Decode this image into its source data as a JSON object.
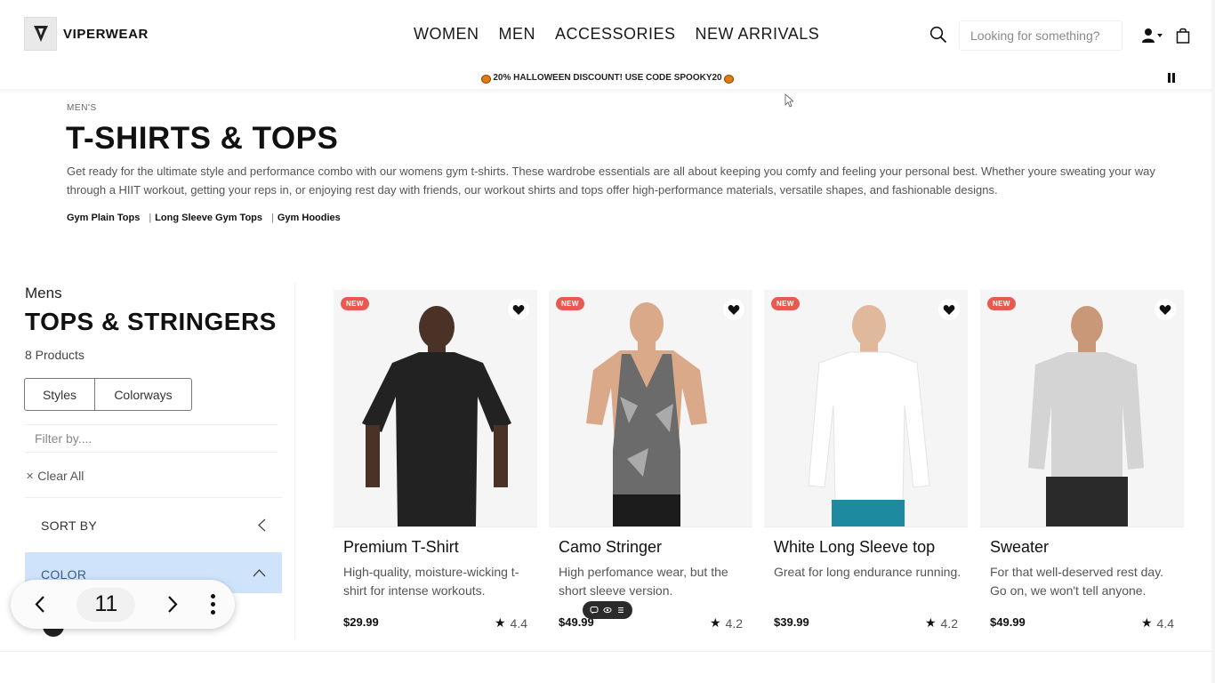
{
  "header": {
    "brand": "VIPERWEAR",
    "nav": [
      "WOMEN",
      "MEN",
      "ACCESSORIES",
      "NEW ARRIVALS"
    ],
    "search_placeholder": "Looking for something?",
    "icons": [
      "viper-logo-icon",
      "search-icon",
      "user-icon",
      "shopping-bag-icon"
    ]
  },
  "promo": {
    "text": "20% HALLOWEEN DISCOUNT! USE CODE SPOOKY20",
    "icon": "pumpkin-icon",
    "control": "pause-icon"
  },
  "intro": {
    "breadcrumb": "MEN'S",
    "title": "T-SHIRTS & TOPS",
    "description": "Get ready for the ultimate style and performance combo with our womens gym t-shirts. These wardrobe essentials are all about keeping you comfy and feeling your personal best. Whether youre sweating your way through a HIIT workout, getting your reps in, or enjoying rest day with friends, our workout shirts and tops offer high-performance materials, versatile shapes, and fashionable designs.",
    "links": [
      "Gym Plain Tops",
      "Long Sleeve Gym Tops",
      "Gym Hoodies"
    ]
  },
  "sidebar": {
    "label": "Mens",
    "title": "TOPS & STRINGERS",
    "count": "8 Products",
    "tabs": [
      "Styles",
      "Colorways"
    ],
    "filter_placeholder": "Filter by....",
    "clear_all": "Clear All",
    "sort_by": "SORT BY",
    "color": "COLOR"
  },
  "pager": {
    "page": "11"
  },
  "products": [
    {
      "badge": "NEW",
      "name": "Premium T-Shirt",
      "description": "High-quality, moisture-wicking t-shirt for intense workouts.",
      "price": "$29.99",
      "rating": "4.4"
    },
    {
      "badge": "NEW",
      "name": "Camo Stringer",
      "description": "High perfomance wear, but the short sleeve version.",
      "price": "$49.99",
      "rating": "4.2"
    },
    {
      "badge": "NEW",
      "name": "White Long Sleeve top",
      "description": "Great for long endurance running.",
      "price": "$39.99",
      "rating": "4.2"
    },
    {
      "badge": "NEW",
      "name": "Sweater",
      "description": "For that well-deserved rest day. Go on, we won't tell anyone.",
      "price": "$49.99",
      "rating": "4.4"
    }
  ],
  "colors": {
    "accent_filter": "#cfe3fb",
    "badge": "#e85a4f",
    "text": "#111111"
  }
}
